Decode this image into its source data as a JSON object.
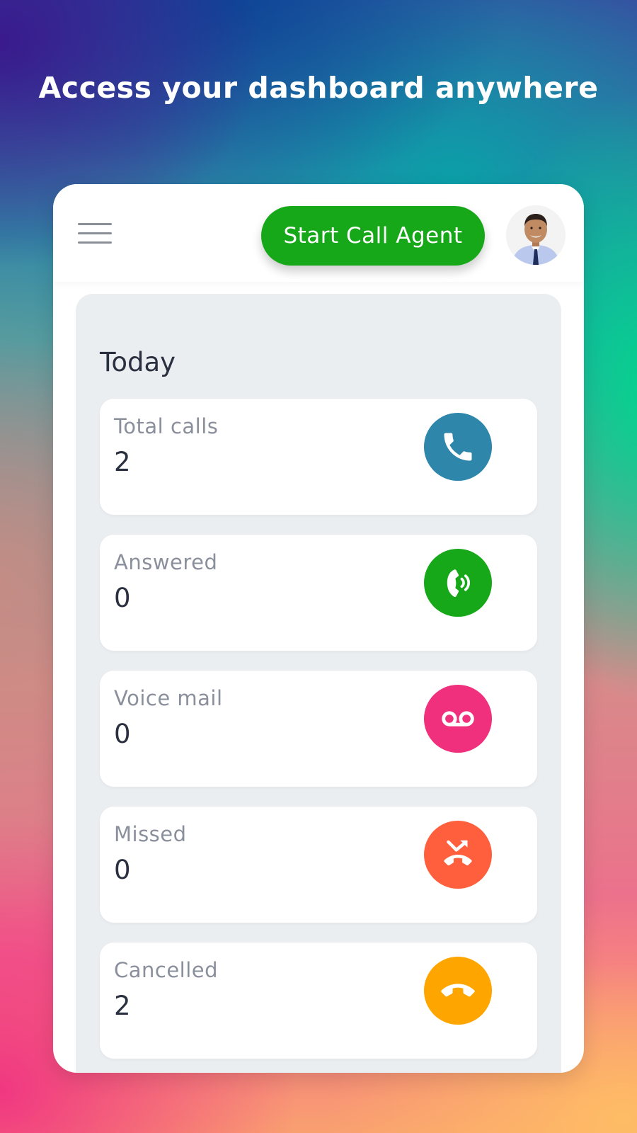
{
  "headline": "Access your dashboard anywhere",
  "header": {
    "start_button_label": "Start Call Agent"
  },
  "dashboard": {
    "section_title": "Today",
    "stats": [
      {
        "label": "Total calls",
        "value": "2",
        "icon": "phone-icon",
        "color": "#2e86ab"
      },
      {
        "label": "Answered",
        "value": "0",
        "icon": "phone-ringing-icon",
        "color": "#17a81a"
      },
      {
        "label": "Voice mail",
        "value": "0",
        "icon": "voicemail-icon",
        "color": "#f0307c"
      },
      {
        "label": "Missed",
        "value": "0",
        "icon": "missed-call-icon",
        "color": "#ff5f3c"
      },
      {
        "label": "Cancelled",
        "value": "2",
        "icon": "hangup-icon",
        "color": "#ffa500"
      }
    ]
  },
  "colors": {
    "brand_green": "#17a81a",
    "card_background": "#ffffff",
    "panel_background": "#ebeef1",
    "text_dark": "#2b3040",
    "text_muted": "#8a8f9c"
  }
}
